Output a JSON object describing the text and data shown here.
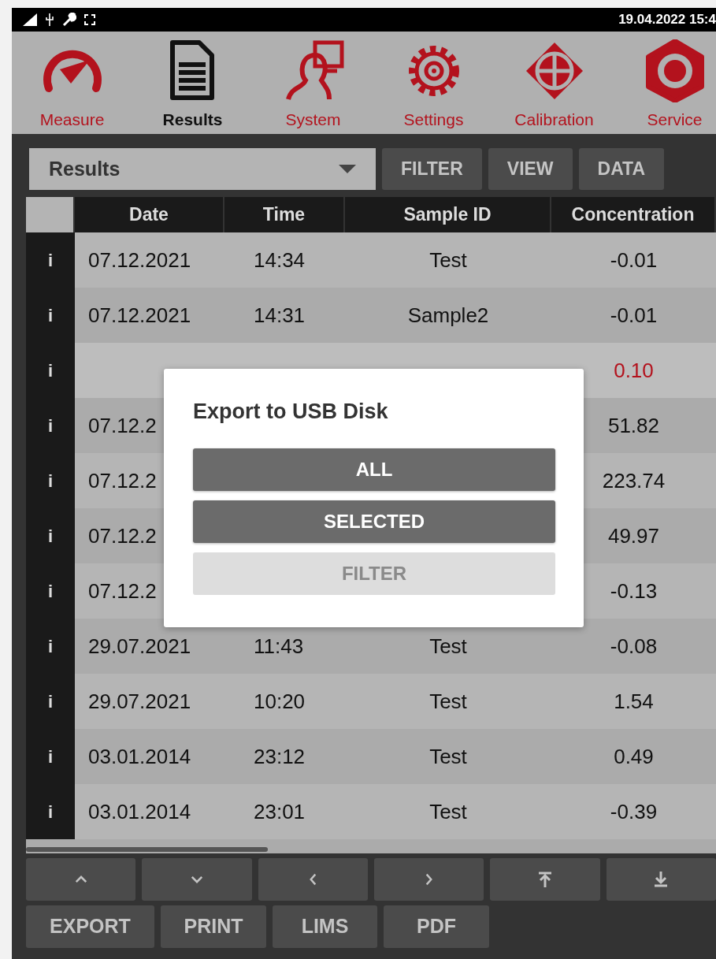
{
  "status_bar": {
    "datetime": "19.04.2022 15:4"
  },
  "nav": [
    {
      "label": "Measure",
      "selected": false
    },
    {
      "label": "Results",
      "selected": true
    },
    {
      "label": "System",
      "selected": false
    },
    {
      "label": "Settings",
      "selected": false
    },
    {
      "label": "Calibration",
      "selected": false
    },
    {
      "label": "Service",
      "selected": false
    }
  ],
  "toolbar": {
    "dropdown": "Results",
    "buttons": [
      "FILTER",
      "VIEW",
      "DATA"
    ]
  },
  "table": {
    "columns": [
      "Date",
      "Time",
      "Sample ID",
      "Concentration"
    ],
    "rows": [
      {
        "info": "i",
        "date": "07.12.2021",
        "time": "14:34",
        "sample_id": "Test",
        "concentration": "-0.01",
        "selected": false
      },
      {
        "info": "i",
        "date": "07.12.2021",
        "time": "14:31",
        "sample_id": "Sample2",
        "concentration": "-0.01",
        "selected": false
      },
      {
        "info": "i",
        "concentration": "0.10",
        "selected": true
      },
      {
        "info": "i",
        "date": "07.12.2",
        "concentration": "51.82",
        "selected": false
      },
      {
        "info": "i",
        "date": "07.12.2",
        "concentration": "223.74",
        "selected": false
      },
      {
        "info": "i",
        "date": "07.12.2",
        "concentration": "49.97",
        "selected": false
      },
      {
        "info": "i",
        "date": "07.12.2",
        "concentration": "-0.13",
        "selected": false
      },
      {
        "info": "i",
        "date": "29.07.2021",
        "time": "11:43",
        "sample_id": "Test",
        "concentration": "-0.08",
        "selected": false
      },
      {
        "info": "i",
        "date": "29.07.2021",
        "time": "10:20",
        "sample_id": "Test",
        "concentration": "1.54",
        "selected": false
      },
      {
        "info": "i",
        "date": "03.01.2014",
        "time": "23:12",
        "sample_id": "Test",
        "concentration": "0.49",
        "selected": false
      },
      {
        "info": "i",
        "date": "03.01.2014",
        "time": "23:01",
        "sample_id": "Test",
        "concentration": "-0.39",
        "selected": false
      }
    ]
  },
  "action_buttons": [
    "EXPORT",
    "PRINT",
    "LIMS",
    "PDF"
  ],
  "dialog": {
    "title": "Export to USB Disk",
    "options": [
      {
        "label": "ALL",
        "disabled": false
      },
      {
        "label": "SELECTED",
        "disabled": false
      },
      {
        "label": "FILTER",
        "disabled": true
      }
    ]
  }
}
